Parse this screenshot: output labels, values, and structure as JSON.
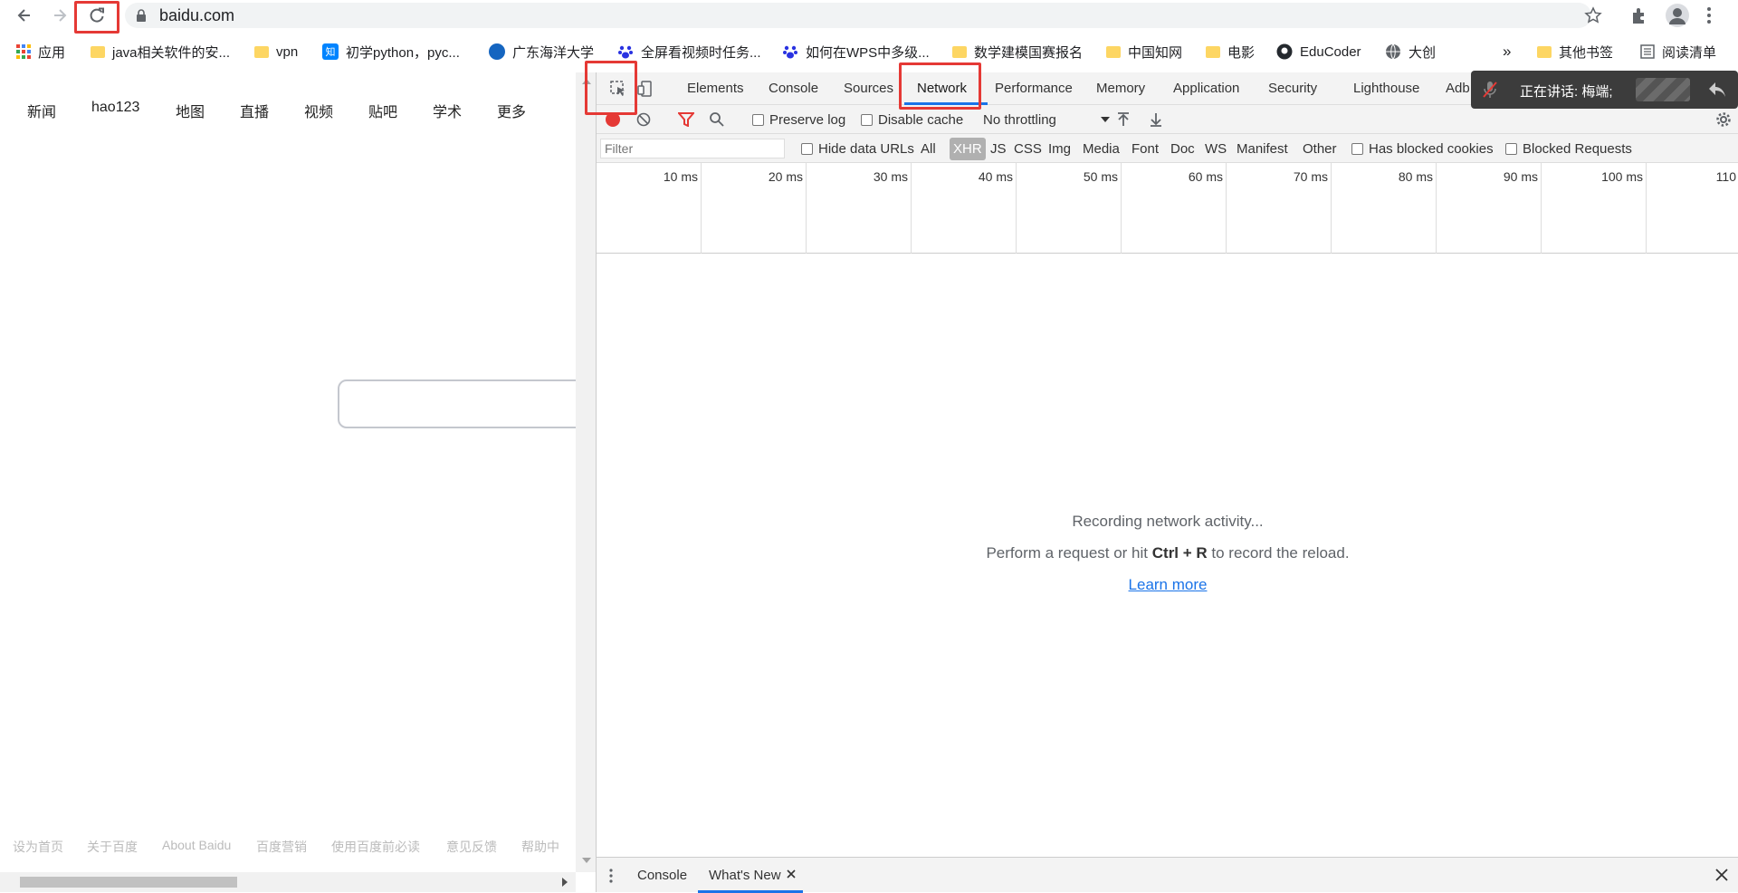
{
  "browser": {
    "url": "baidu.com",
    "bookmarks": [
      {
        "label": "应用",
        "icon": "apps-grid-icon"
      },
      {
        "label": "java相关软件的安...",
        "icon": "folder-icon"
      },
      {
        "label": "vpn",
        "icon": "folder-icon"
      },
      {
        "label": "初学python，pyc...",
        "icon": "zhihu-icon",
        "badge": "知"
      },
      {
        "label": "广东海洋大学",
        "icon": "university-icon"
      },
      {
        "label": "全屏看视频时任务...",
        "icon": "baidu-paw-icon"
      },
      {
        "label": "如何在WPS中多级...",
        "icon": "baidu-paw-icon"
      },
      {
        "label": "数学建模国赛报名",
        "icon": "folder-icon"
      },
      {
        "label": "中国知网",
        "icon": "folder-icon"
      },
      {
        "label": "电影",
        "icon": "folder-icon"
      },
      {
        "label": "EduCoder",
        "icon": "github-icon"
      },
      {
        "label": "大创",
        "icon": "globe-icon"
      }
    ],
    "overflow": "»",
    "other_bookmarks": "其他书签",
    "reading_list": "阅读清单"
  },
  "page": {
    "nav": [
      "新闻",
      "hao123",
      "地图",
      "直播",
      "视频",
      "贴吧",
      "学术",
      "更多"
    ],
    "footer": [
      "设为首页",
      "关于百度",
      "About Baidu",
      "百度营销",
      "使用百度前必读",
      "意见反馈",
      "帮助中"
    ]
  },
  "devtools": {
    "tabs": [
      "Elements",
      "Console",
      "Sources",
      "Network",
      "Performance",
      "Memory",
      "Application",
      "Security",
      "Lighthouse",
      "Adb"
    ],
    "active_tab": "Network",
    "preserve_log": "Preserve log",
    "disable_cache": "Disable cache",
    "throttling": "No throttling",
    "filter_placeholder": "Filter",
    "hide_data_urls": "Hide data URLs",
    "types": [
      "All",
      "XHR",
      "JS",
      "CSS",
      "Img",
      "Media",
      "Font",
      "Doc",
      "WS",
      "Manifest",
      "Other"
    ],
    "active_type": "XHR",
    "has_blocked_cookies": "Has blocked cookies",
    "blocked_requests": "Blocked Requests",
    "ticks": [
      "10 ms",
      "20 ms",
      "30 ms",
      "40 ms",
      "50 ms",
      "60 ms",
      "70 ms",
      "80 ms",
      "90 ms",
      "100 ms",
      "110"
    ],
    "empty_line1": "Recording network activity...",
    "empty_line2_pre": "Perform a request or hit ",
    "empty_line2_key": "Ctrl + R",
    "empty_line2_post": " to record the reload.",
    "learn_more": "Learn more",
    "drawer_tabs": [
      "Console",
      "What's New"
    ],
    "drawer_active": "What's New"
  },
  "call_banner": {
    "text": "正在讲话: 梅端;"
  },
  "colors": {
    "accent": "#1a73e8",
    "record_red": "#e53935",
    "annotation_red": "#e53935"
  }
}
